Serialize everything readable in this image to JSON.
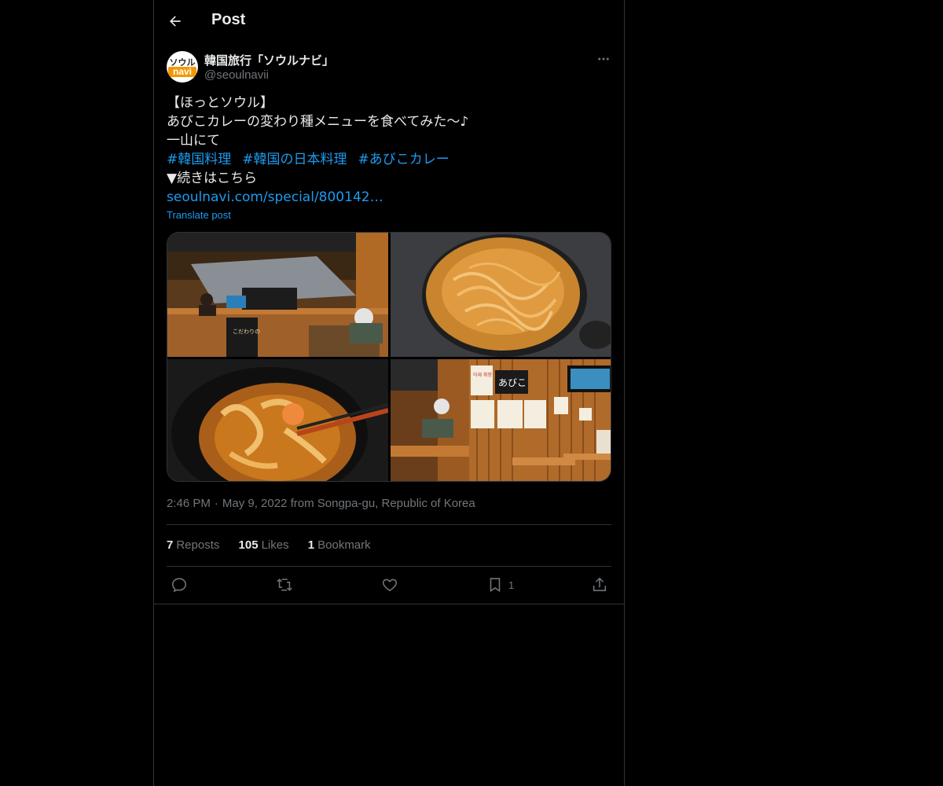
{
  "header": {
    "title": "Post"
  },
  "author": {
    "display_name": "韓国旅行「ソウルナビ」",
    "handle": "@seoulnavii",
    "avatar_top": "ソウル",
    "avatar_bottom": "navi"
  },
  "post": {
    "lines": [
      "【ほっとソウル】",
      "あびこカレーの変わり種メニューを食べてみた〜♪",
      "一山にて"
    ],
    "hashtags": [
      "#韓国料理",
      "#韓国の日本料理",
      "#あびこカレー"
    ],
    "continue_text": "▼続きはこちら",
    "link_text": "seoulnavi.com/special/800142…",
    "translate_label": "Translate post",
    "photo_signs": {
      "restaurant_banner": "こだわりの",
      "wall_poster_1": "아재\n취향",
      "wall_logo": "あびこ"
    }
  },
  "meta": {
    "time": "2:46 PM",
    "separator": "·",
    "date_location": "May 9, 2022 from Songpa-gu, Republic of Korea"
  },
  "stats": {
    "reposts_count": "7",
    "reposts_label": "Reposts",
    "likes_count": "105",
    "likes_label": "Likes",
    "bookmarks_count": "1",
    "bookmarks_label": "Bookmark"
  },
  "actions": {
    "bookmark_count": "1"
  },
  "colors": {
    "background": "#000000",
    "text": "#e7e9ea",
    "muted": "#71767b",
    "accent": "#1d9bf0",
    "border": "#2f3336"
  },
  "icons": {
    "back": "arrow-left-icon",
    "more": "more-horizontal-icon",
    "reply": "reply-icon",
    "repost": "repost-icon",
    "like": "heart-icon",
    "bookmark": "bookmark-icon",
    "share": "share-icon"
  }
}
